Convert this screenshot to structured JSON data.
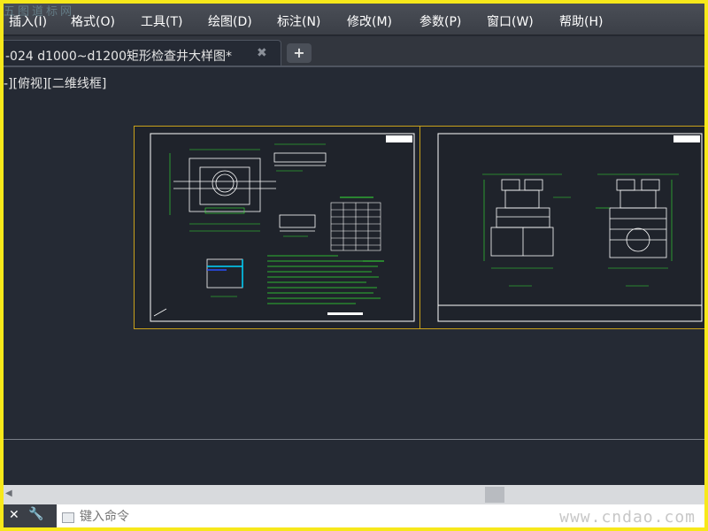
{
  "watermark_top": "五图道标网",
  "menu": [
    "插入(I)",
    "格式(O)",
    "工具(T)",
    "绘图(D)",
    "标注(N)",
    "修改(M)",
    "参数(P)",
    "窗口(W)",
    "帮助(H)"
  ],
  "tab": {
    "title": "-024  d1000~d1200矩形检查井大样图*",
    "close_symbol": "✖",
    "add_symbol": "+"
  },
  "viewport_label": "-][俯视][二维线框]",
  "command": {
    "close_symbol": "✕",
    "wrench_symbol": "🔧",
    "placeholder": "键入命令"
  },
  "watermark_bottom": "www.cndao.com",
  "colors": {
    "background": "#252a34",
    "border": "#f7e81a",
    "sheet_border": "#c9a11b",
    "cad_green": "#35e635",
    "cad_white": "#ffffff",
    "cad_cyan": "#00d4ff"
  }
}
